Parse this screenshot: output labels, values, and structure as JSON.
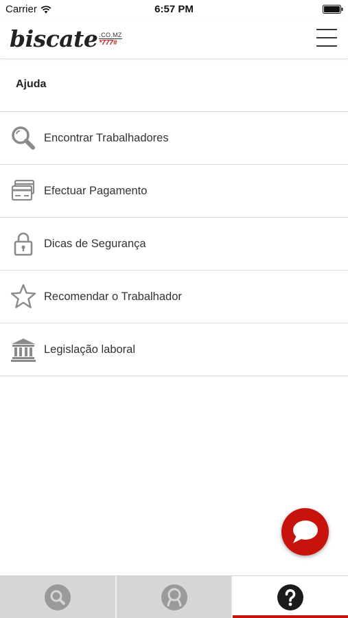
{
  "status_bar": {
    "carrier": "Carrier",
    "time": "6:57 PM"
  },
  "header": {
    "logo_word": "biscate",
    "logo_domain": ".CO.MZ",
    "logo_code": "*777#"
  },
  "page": {
    "title": "Ajuda"
  },
  "help_items": [
    {
      "label": "Encontrar Trabalhadores",
      "icon": "search-icon"
    },
    {
      "label": "Efectuar Pagamento",
      "icon": "card-icon"
    },
    {
      "label": "Dicas de Segurança",
      "icon": "lock-icon"
    },
    {
      "label": "Recomendar o Trabalhador",
      "icon": "star-icon"
    },
    {
      "label": "Legislação laboral",
      "icon": "bank-icon"
    }
  ],
  "tabs": [
    {
      "name": "search",
      "icon": "search-icon",
      "active": false
    },
    {
      "name": "profile",
      "icon": "person-icon",
      "active": false
    },
    {
      "name": "help",
      "icon": "question-icon",
      "active": true
    }
  ],
  "colors": {
    "accent": "#c8120c",
    "icon_gray": "#8a8a8a",
    "tab_inactive_bg": "#d6d6d6"
  }
}
